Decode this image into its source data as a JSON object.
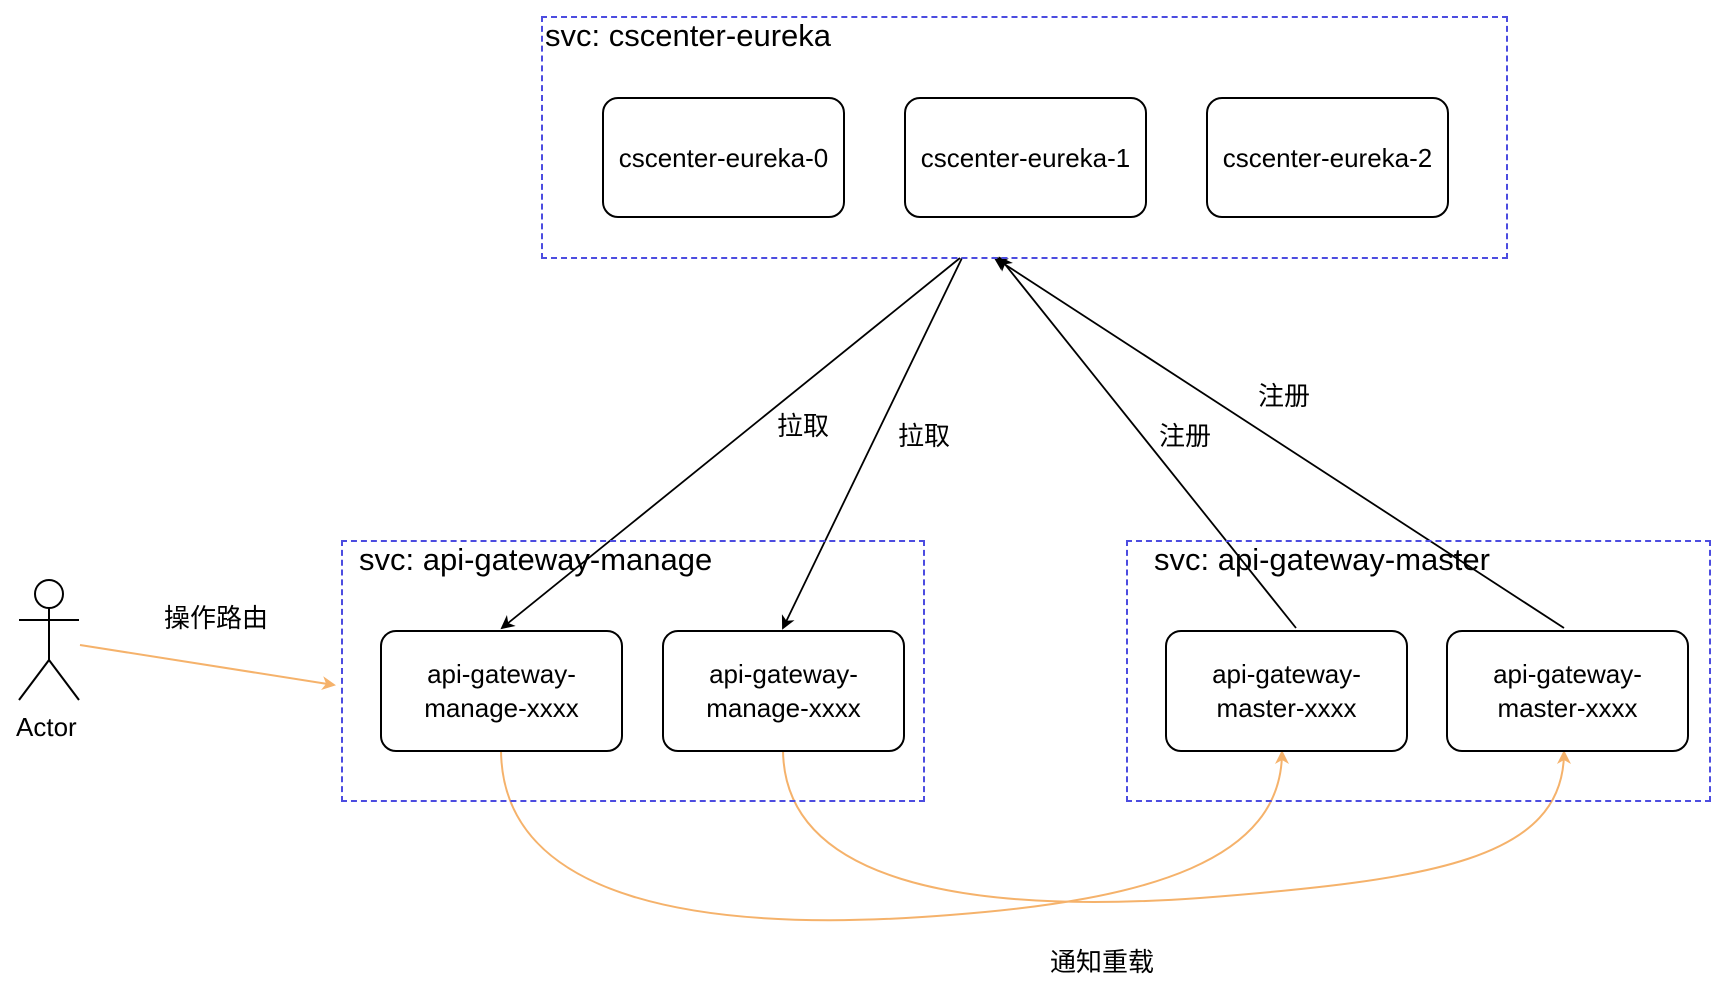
{
  "groups": {
    "eureka": {
      "title": "svc: cscenter-eureka"
    },
    "manage": {
      "title": "svc: api-gateway-manage"
    },
    "master": {
      "title": "svc: api-gateway-master"
    }
  },
  "nodes": {
    "eureka0": {
      "label": "cscenter-eureka-0"
    },
    "eureka1": {
      "label": "cscenter-eureka-1"
    },
    "eureka2": {
      "label": "cscenter-eureka-2"
    },
    "manage1": {
      "line1": "api-gateway-",
      "line2": "manage-xxxx"
    },
    "manage2": {
      "line1": "api-gateway-",
      "line2": "manage-xxxx"
    },
    "master1": {
      "line1": "api-gateway-",
      "line2": "master-xxxx"
    },
    "master2": {
      "line1": "api-gateway-",
      "line2": "master-xxxx"
    }
  },
  "actor": {
    "label": "Actor"
  },
  "edge_labels": {
    "pull1": "拉取",
    "pull2": "拉取",
    "register1": "注册",
    "register2": "注册",
    "operate_route": "操作路由",
    "notify_reload": "通知重载"
  },
  "colors": {
    "group_border": "#4c4ce0",
    "black_edge": "#000000",
    "orange_edge": "#f5b26b"
  }
}
